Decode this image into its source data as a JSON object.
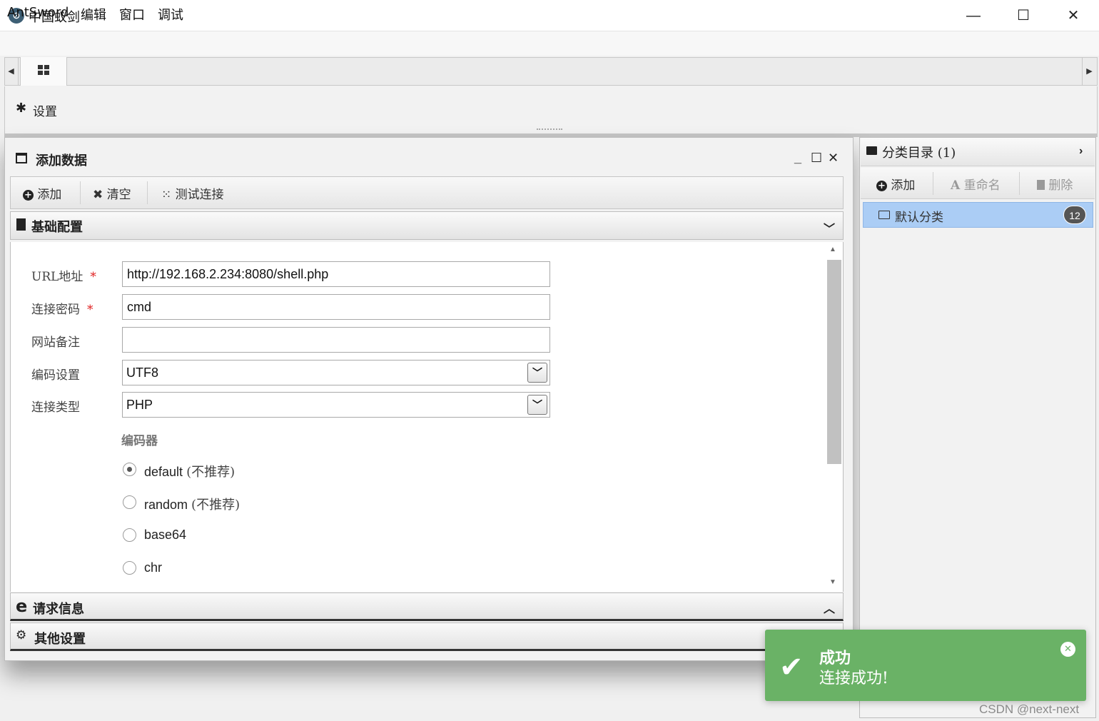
{
  "window": {
    "title": "中国蚁剑",
    "controls": {
      "minimize": "—",
      "maximize": "☐",
      "close": "✕"
    }
  },
  "menu": [
    "AntSword",
    "编辑",
    "窗口",
    "调试"
  ],
  "tabs": {
    "prev_arrow": "◀",
    "next_arrow": "▶",
    "home_icon": "grid-icon"
  },
  "settings": {
    "label": "设置",
    "icon": "gear-icon"
  },
  "add_data_panel": {
    "title": "添加数据",
    "controls": {
      "minimize": "_",
      "maximize": "☐",
      "close": "✕"
    },
    "toolbar": {
      "add": "添加",
      "clear": "清空",
      "test_connection": "测试连接"
    }
  },
  "sections": {
    "basic": "基础配置",
    "request": "请求信息",
    "other": "其他设置"
  },
  "form": {
    "url": {
      "label": "URL地址",
      "required": "*",
      "value": "http://192.168.2.234:8080/shell.php"
    },
    "password": {
      "label": "连接密码",
      "required": "*",
      "value": "cmd"
    },
    "note": {
      "label": "网站备注",
      "value": ""
    },
    "encoding": {
      "label": "编码设置",
      "value": "UTF8"
    },
    "type": {
      "label": "连接类型",
      "value": "PHP"
    },
    "encoder": {
      "label": "编码器",
      "options": [
        {
          "name": "default",
          "suffix": "(不推荐)",
          "checked": true
        },
        {
          "name": "random",
          "suffix": "(不推荐)",
          "checked": false
        },
        {
          "name": "base64",
          "suffix": "",
          "checked": false
        },
        {
          "name": "chr",
          "suffix": "",
          "checked": false
        }
      ]
    }
  },
  "category": {
    "title": "分类目录 (1)",
    "toolbar": {
      "add": "添加",
      "rename": "重命名",
      "delete": "删除"
    },
    "items": [
      {
        "label": "默认分类",
        "count": "12"
      }
    ]
  },
  "toast": {
    "title": "成功",
    "message": "连接成功!",
    "close": "✕"
  },
  "watermark": "CSDN @next-next",
  "colors": {
    "toast_bg": "#6ab266",
    "selected_item": "#abcdf5",
    "required": "#e02020"
  }
}
